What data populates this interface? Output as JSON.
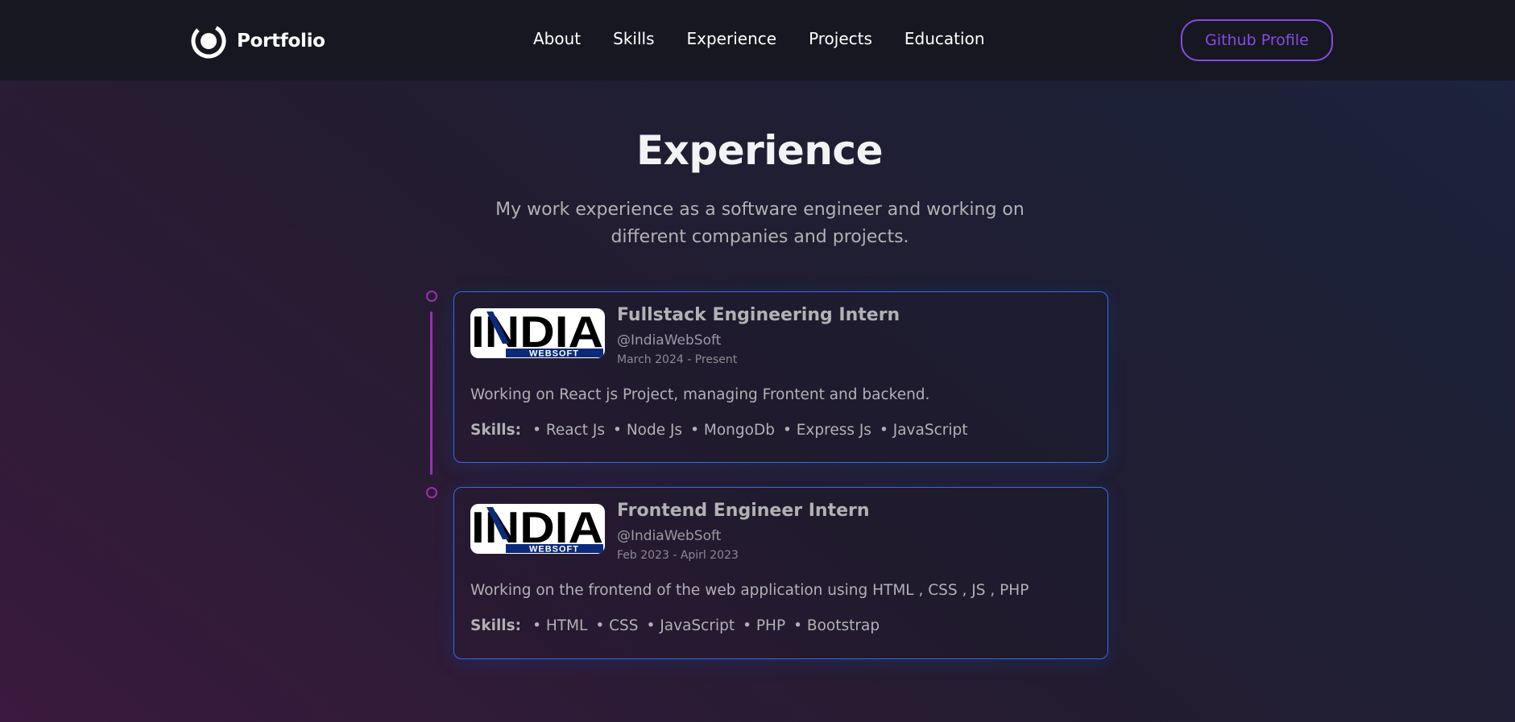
{
  "brand": {
    "name": "Portfolio"
  },
  "nav": {
    "links": [
      "About",
      "Skills",
      "Experience",
      "Projects",
      "Education"
    ]
  },
  "github_button": "Github Profile",
  "section": {
    "title": "Experience",
    "description_line1": "My work experience as a software engineer and working on",
    "description_line2": "different companies and projects."
  },
  "logo_image": {
    "main_text": "INDIA",
    "sub_text": "WEBSOFT"
  },
  "experiences": [
    {
      "role": "Fullstack Engineering Intern",
      "company": "@IndiaWebSoft",
      "date": "March 2024 - Present",
      "description": "Working on React js Project, managing Frontent and backend.",
      "skills_label": "Skills:",
      "skills": [
        "React Js",
        "Node Js",
        "MongoDb",
        "Express Js",
        "JavaScript"
      ]
    },
    {
      "role": "Frontend Engineer Intern",
      "company": "@IndiaWebSoft",
      "date": "Feb 2023 - Apirl 2023",
      "description": "Working on the frontend of the web application using HTML , CSS , JS , PHP",
      "skills_label": "Skills:",
      "skills": [
        "HTML",
        "CSS",
        "JavaScript",
        "PHP",
        "Bootstrap"
      ]
    }
  ],
  "colors": {
    "accent": "#854ce6",
    "timeline": "#9b2fb5",
    "card_border": "#306ee8",
    "nav_bg": "#171721",
    "logo_blue": "#0c2a7a"
  }
}
